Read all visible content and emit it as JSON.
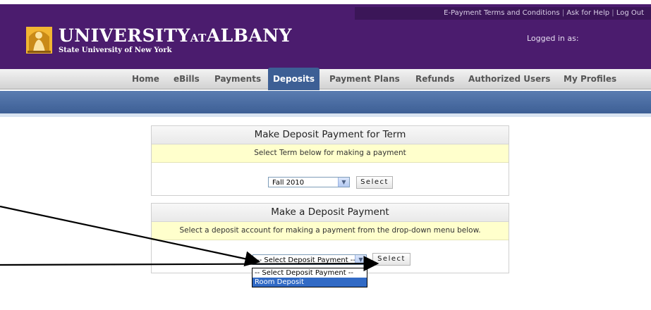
{
  "header": {
    "links": [
      "E-Payment Terms and Conditions",
      "Ask for Help",
      "Log Out"
    ],
    "logged_in_label": "Logged in as:",
    "brand_university": "UNIVERSITY",
    "brand_at": "AT",
    "brand_albany": "ALBANY",
    "tagline": "State University of New York"
  },
  "nav": {
    "items": [
      "Home",
      "eBills",
      "Payments",
      "Deposits",
      "Payment Plans",
      "Refunds",
      "Authorized Users",
      "My Profiles"
    ],
    "active": "Deposits"
  },
  "term_panel": {
    "title": "Make Deposit Payment for Term",
    "instruction": "Select Term below for making a payment",
    "selected_term": "Fall 2010",
    "button_label": "Select"
  },
  "deposit_panel": {
    "title": "Make a Deposit Payment",
    "instruction": "Select a deposit account for making a payment from the drop-down menu below.",
    "selected_option": "-- Select Deposit Payment --",
    "button_label": "Select",
    "options": [
      "-- Select Deposit Payment --",
      "Room Deposit"
    ],
    "highlighted_option": "Room Deposit"
  },
  "colors": {
    "header_purple": "#4b1c6e",
    "nav_blue": "#3d5f95",
    "instruction_yellow": "#ffffcc",
    "highlight_blue": "#316ac5"
  }
}
